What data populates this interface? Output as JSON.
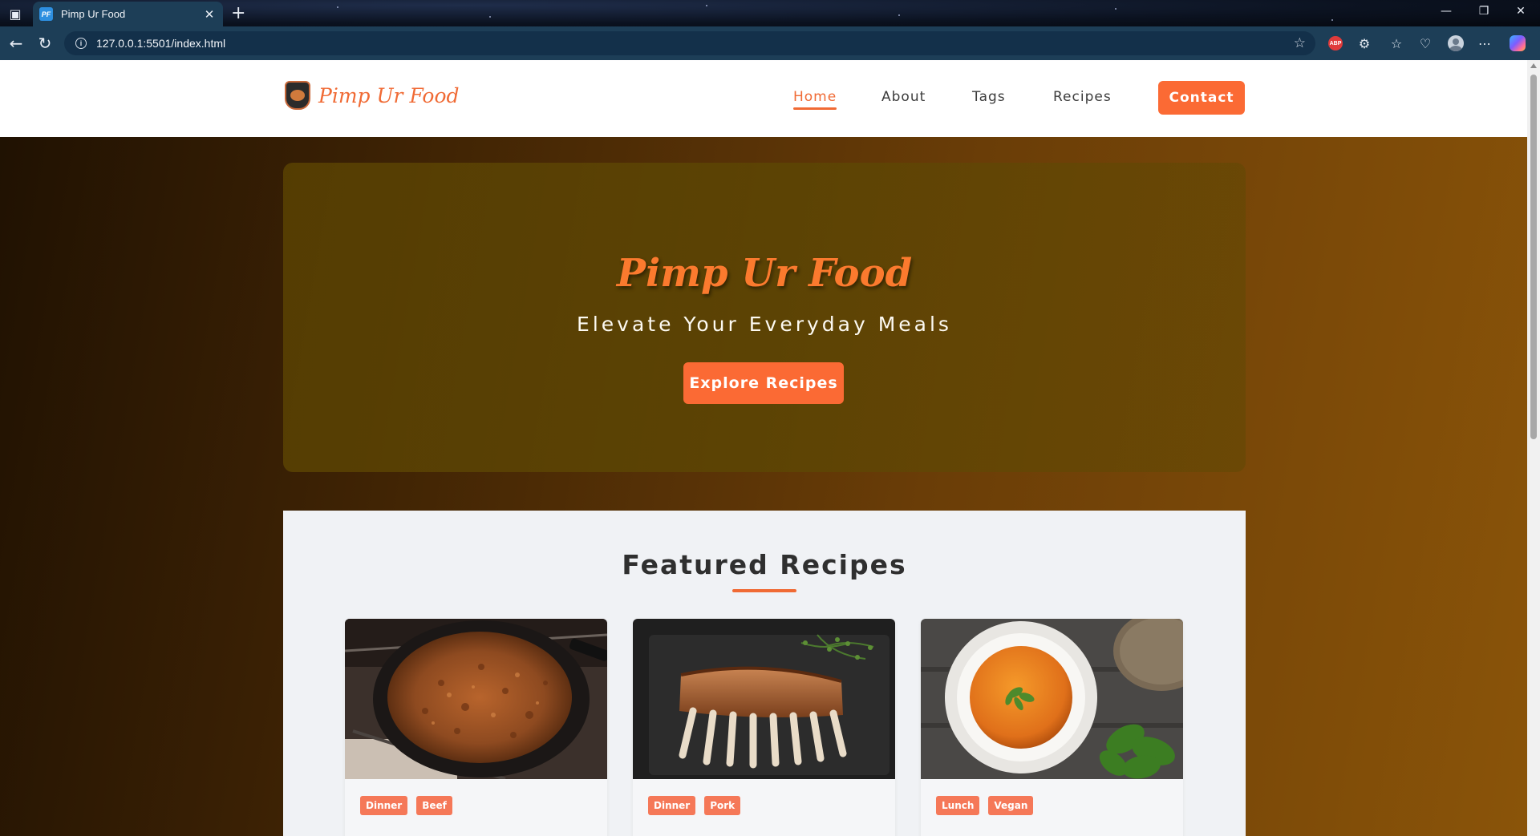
{
  "browser": {
    "tab_title": "Pimp Ur Food",
    "tab_favicon_text": "PF",
    "url": "127.0.0.1:5501/index.html",
    "abp_label": "ABP"
  },
  "site": {
    "logo_text": "Pimp Ur Food",
    "nav": [
      {
        "label": "Home",
        "active": true
      },
      {
        "label": "About",
        "active": false
      },
      {
        "label": "Tags",
        "active": false
      },
      {
        "label": "Recipes",
        "active": false
      }
    ],
    "contact_label": "Contact"
  },
  "hero": {
    "title": "Pimp Ur Food",
    "subtitle": "Elevate Your Everyday Meals",
    "button": "Explore Recipes"
  },
  "featured": {
    "title": "Featured Recipes",
    "cards": [
      {
        "image": "pan-of-ground-meat",
        "tags": [
          "Dinner",
          "Beef"
        ]
      },
      {
        "image": "grilled-ribs",
        "tags": [
          "Dinner",
          "Pork"
        ]
      },
      {
        "image": "pumpkin-soup",
        "tags": [
          "Lunch",
          "Vegan"
        ]
      }
    ]
  },
  "colors": {
    "accent": "#fb6a34",
    "browser_chrome": "#1d3e57",
    "tag_bg": "#f57858"
  }
}
